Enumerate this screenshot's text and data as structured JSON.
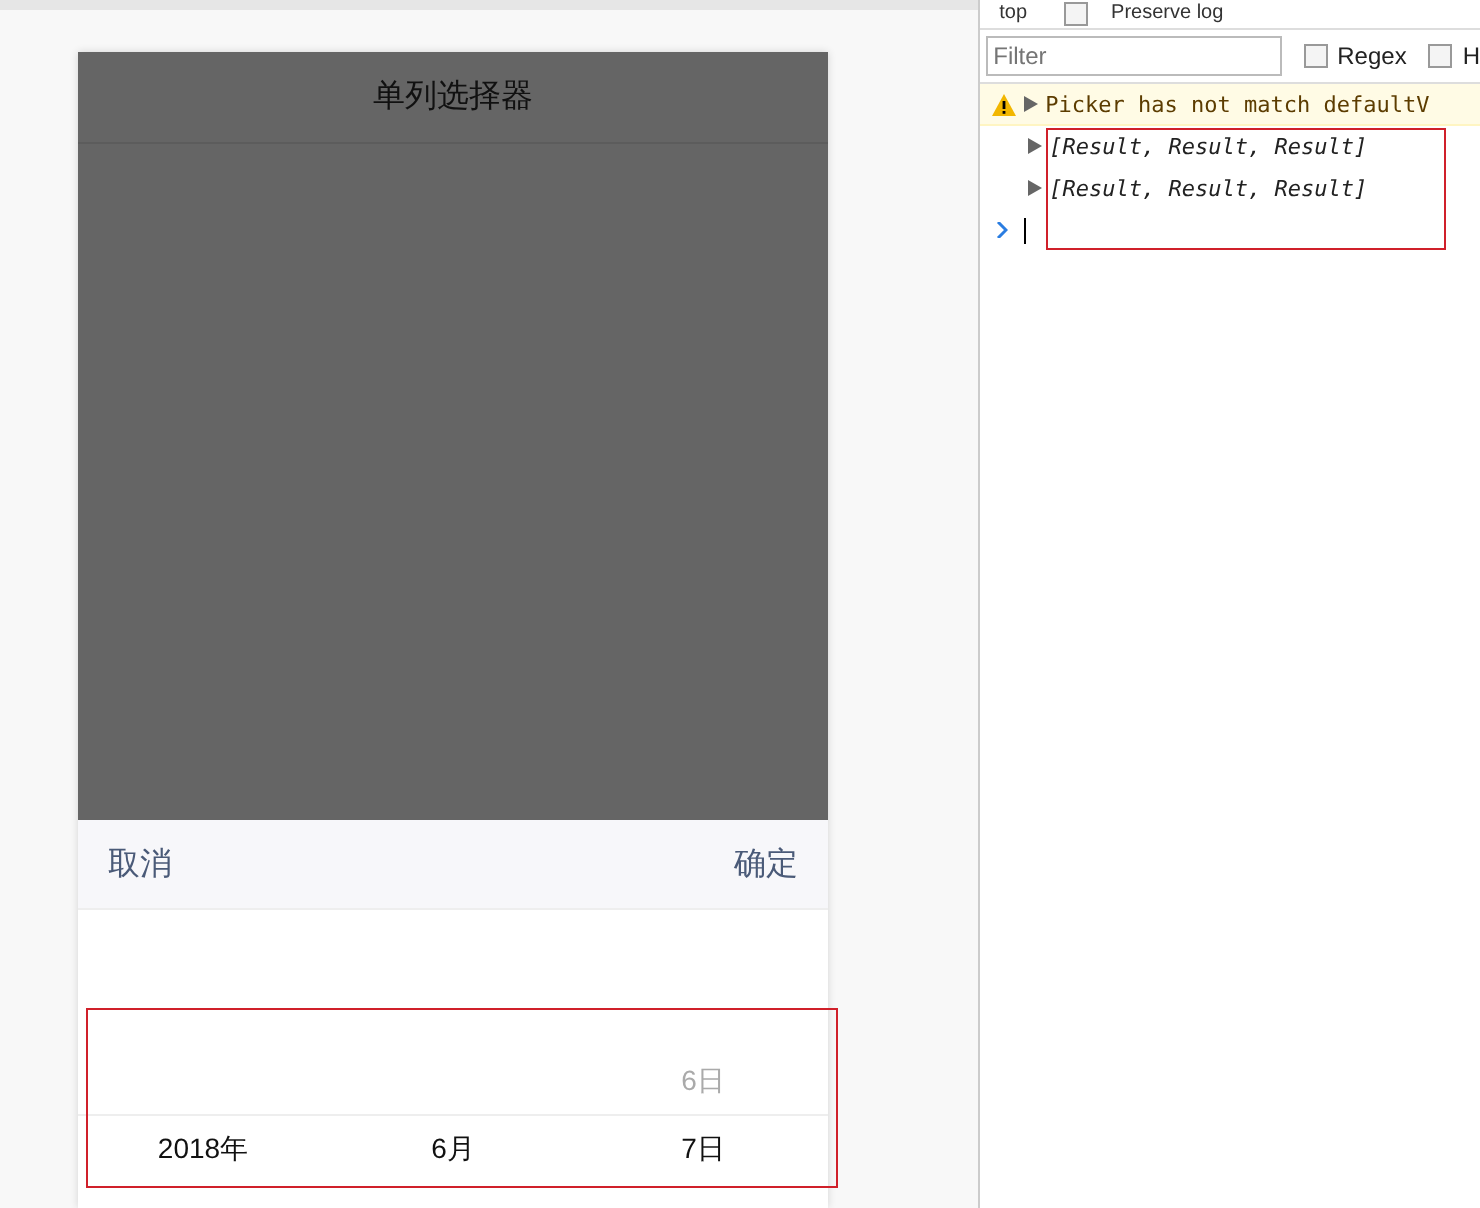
{
  "page": {
    "header_title": "单列选择器",
    "toolbar": {
      "cancel": "取消",
      "confirm": "确定"
    },
    "picker_columns": [
      {
        "items": [
          {
            "text": "2018年",
            "selected": true
          }
        ]
      },
      {
        "items": [
          {
            "text": "6月",
            "selected": true
          }
        ]
      },
      {
        "items": [
          {
            "text": "6日",
            "selected": false
          },
          {
            "text": "7日",
            "selected": true
          }
        ]
      }
    ]
  },
  "devtools": {
    "context": "top",
    "preserve_log": {
      "label": "Preserve log",
      "checked": false
    },
    "filter": {
      "placeholder": "Filter"
    },
    "regex": {
      "label": "Regex",
      "checked": false
    },
    "hide": {
      "label": "H",
      "checked": false
    },
    "messages": [
      {
        "kind": "warning",
        "text": "Picker has not match defaultV"
      },
      {
        "kind": "log",
        "text": "[Result, Result, Result]"
      },
      {
        "kind": "log",
        "text": "[Result, Result, Result]"
      }
    ]
  }
}
